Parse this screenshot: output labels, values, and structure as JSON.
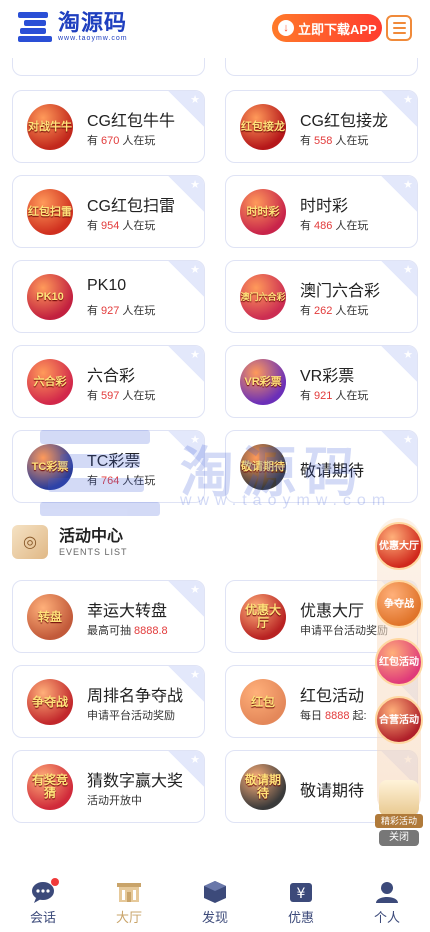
{
  "header": {
    "logo_title": "淘源码",
    "logo_sub": "www.taoymw.com",
    "download_label": "立即下载APP",
    "brand_color": "#1f3fbf",
    "accent_color": "#ff4d2a"
  },
  "games": [
    {
      "name": "CG红包牛牛",
      "prefix": "有",
      "count": "670",
      "suffix": "人在玩",
      "icon_text": "对战牛牛",
      "icon_color": "#c2281c"
    },
    {
      "name": "CG红包接龙",
      "prefix": "有",
      "count": "558",
      "suffix": "人在玩",
      "icon_text": "红包接龙",
      "icon_color": "#b5171a"
    },
    {
      "name": "CG红包扫雷",
      "prefix": "有",
      "count": "954",
      "suffix": "人在玩",
      "icon_text": "红包扫雷",
      "icon_color": "#d0301f"
    },
    {
      "name": "时时彩",
      "prefix": "有",
      "count": "486",
      "suffix": "人在玩",
      "icon_text": "时时彩",
      "icon_color": "#c8244a"
    },
    {
      "name": "PK10",
      "prefix": "有",
      "count": "927",
      "suffix": "人在玩",
      "icon_text": "PK10",
      "icon_color": "#c2203f"
    },
    {
      "name": "澳门六合彩",
      "prefix": "有",
      "count": "262",
      "suffix": "人在玩",
      "icon_text": "澳门六合彩",
      "icon_color": "#cc2d52"
    },
    {
      "name": "六合彩",
      "prefix": "有",
      "count": "597",
      "suffix": "人在玩",
      "icon_text": "六合彩",
      "icon_color": "#d2284a"
    },
    {
      "name": "VR彩票",
      "prefix": "有",
      "count": "921",
      "suffix": "人在玩",
      "icon_text": "VR彩票",
      "icon_color": "#6b2fb8"
    },
    {
      "name": "TC彩票",
      "prefix": "有",
      "count": "764",
      "suffix": "人在玩",
      "icon_text": "TC彩票",
      "icon_color": "#2a3c9a"
    },
    {
      "name": "敬请期待",
      "icon_text": "敬请期待",
      "icon_color": "#3a3a3a"
    }
  ],
  "events_section": {
    "title": "活动中心",
    "subtitle": "EVENTS LIST"
  },
  "events": [
    {
      "name": "幸运大转盘",
      "sub_prefix": "最高可抽",
      "sub_value": "8888.8",
      "sub_suffix": "",
      "icon_text": "转盘",
      "icon_color": "#c25a3a"
    },
    {
      "name": "优惠大厅",
      "sub_prefix": "申请平台活动奖励",
      "sub_value": "",
      "sub_suffix": "",
      "icon_text": "优惠大厅",
      "icon_color": "#b82222"
    },
    {
      "name": "周排名争夺战",
      "sub_prefix": "申请平台活动奖励",
      "sub_value": "",
      "sub_suffix": "",
      "icon_text": "争夺战",
      "icon_color": "#c2282c"
    },
    {
      "name": "红包活动",
      "sub_prefix": "每日",
      "sub_value": "8888",
      "sub_suffix": "起:",
      "icon_text": "红包",
      "icon_color": "#e4885a"
    },
    {
      "name": "猜数字赢大奖",
      "sub_prefix": "活动开放中",
      "sub_value": "",
      "sub_suffix": "",
      "icon_text": "有奖竞猜",
      "icon_color": "#d02a3a"
    },
    {
      "name": "敬请期待",
      "sub_prefix": "",
      "sub_value": "",
      "sub_suffix": "",
      "icon_text": "敬请期待",
      "icon_color": "#3a3a3a"
    }
  ],
  "float_promos": {
    "items": [
      {
        "label": "优惠大厅",
        "color": "#d0281c"
      },
      {
        "label": "争夺战",
        "color": "#e0742a"
      },
      {
        "label": "红包活动",
        "color": "#e03a7a"
      },
      {
        "label": "合营活动",
        "color": "#b0202a"
      }
    ],
    "gift_label": "精彩活动",
    "close_label": "关闭"
  },
  "watermark": {
    "title": "淘源码",
    "url": "www.taoymw.com"
  },
  "nav": [
    {
      "label": "会话",
      "icon": "chat-icon",
      "badge": true
    },
    {
      "label": "大厅",
      "icon": "hall-icon",
      "active": true
    },
    {
      "label": "发现",
      "icon": "discover-icon"
    },
    {
      "label": "优惠",
      "icon": "promo-icon"
    },
    {
      "label": "个人",
      "icon": "user-icon"
    }
  ]
}
